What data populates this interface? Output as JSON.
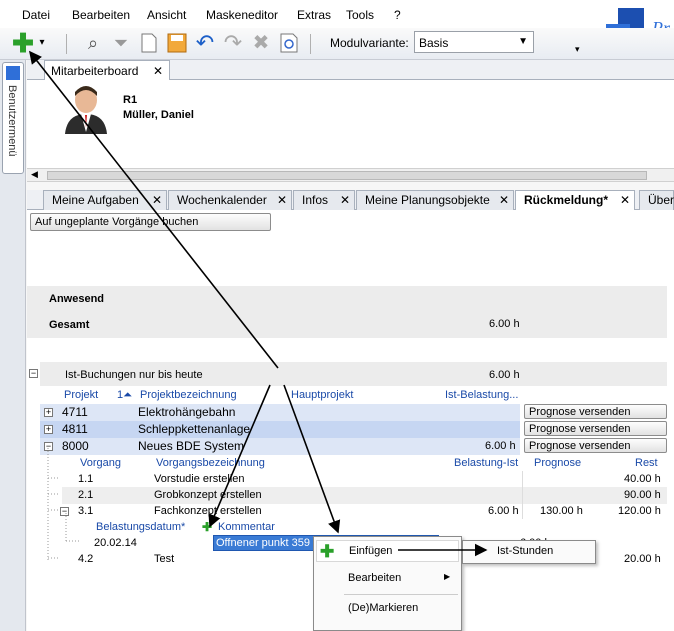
{
  "menubar": {
    "items": [
      "Datei",
      "Bearbeiten",
      "Ansicht",
      "Maskeneditor",
      "Extras",
      "Tools",
      "?"
    ]
  },
  "toolbar": {
    "modulvariante_label": "Modulvariante:",
    "modulvariante_value": "Basis",
    "logo_text": "Pr"
  },
  "sidebar": {
    "vertical_tab": "Benutzermenü"
  },
  "document_tab": {
    "label": "Mitarbeiterboard",
    "close": "✕"
  },
  "header": {
    "code": "R1",
    "name": "Müller, Daniel"
  },
  "tabs": [
    {
      "label": "Meine Aufgaben",
      "close": "✕"
    },
    {
      "label": "Wochenkalender",
      "close": "✕"
    },
    {
      "label": "Infos",
      "close": "✕"
    },
    {
      "label": "Meine Planungsobjekte",
      "close": "✕"
    },
    {
      "label": "Rückmeldung*",
      "close": "✕"
    },
    {
      "label": "Über",
      "close": ""
    }
  ],
  "book_button": "Auf ungeplante Vorgänge buchen",
  "summary": {
    "anwesend": "Anwesend",
    "gesamt": "Gesamt",
    "gesamt_value": "6.00 h",
    "ist_label": "Ist-Buchungen nur bis heute",
    "ist_value": "6.00 h"
  },
  "projects_header": {
    "projekt": "Projekt",
    "sort": "1⏶",
    "bezeichnung": "Projektbezeichnung",
    "hauptprojekt": "Hauptprojekt",
    "belastung": "Ist-Belastung..."
  },
  "projects": [
    {
      "id": "4711",
      "name": "Elektrohängebahn",
      "value": "",
      "button": "Prognose versenden"
    },
    {
      "id": "4811",
      "name": "Schleppkettenanlage",
      "value": "",
      "button": "Prognose versenden"
    },
    {
      "id": "8000",
      "name": "Neues BDE System",
      "value": "6.00 h",
      "button": "Prognose versenden"
    }
  ],
  "vorgang_header": {
    "vorgang": "Vorgang",
    "bezeichnung": "Vorgangsbezeichnung",
    "belastung": "Belastung-Ist",
    "prognose": "Prognose",
    "rest": "Rest"
  },
  "vorgaenge": [
    {
      "nr": "1.1",
      "name": "Vorstudie erstellen",
      "belastung": "",
      "prognose": "",
      "rest": "40.00 h"
    },
    {
      "nr": "2.1",
      "name": "Grobkonzept erstellen",
      "belastung": "",
      "prognose": "",
      "rest": "90.00 h"
    },
    {
      "nr": "3.1",
      "name": "Fachkonzept erstellen",
      "belastung": "6.00 h",
      "prognose": "130.00 h",
      "rest": "120.00 h"
    }
  ],
  "buchung_header": {
    "datum": "Belastungsdatum*",
    "kommentar": "Kommentar"
  },
  "buchung": {
    "datum": "20.02.14",
    "kommentar": "Offnener punkt 359",
    "value": "6.00 h"
  },
  "vorgang_last": {
    "nr": "4.2",
    "name": "Test",
    "rest": "20.00 h"
  },
  "context_menu": {
    "items": [
      "Einfügen",
      "Bearbeiten",
      "(De)Markieren"
    ]
  },
  "submenu": {
    "items": [
      "Ist-Stunden"
    ]
  },
  "colors": {
    "selected_row": "#c6d6f2",
    "project_row": "#dde6f6",
    "header_text": "#1a4aa8",
    "accent_green": "#2aa02a"
  }
}
